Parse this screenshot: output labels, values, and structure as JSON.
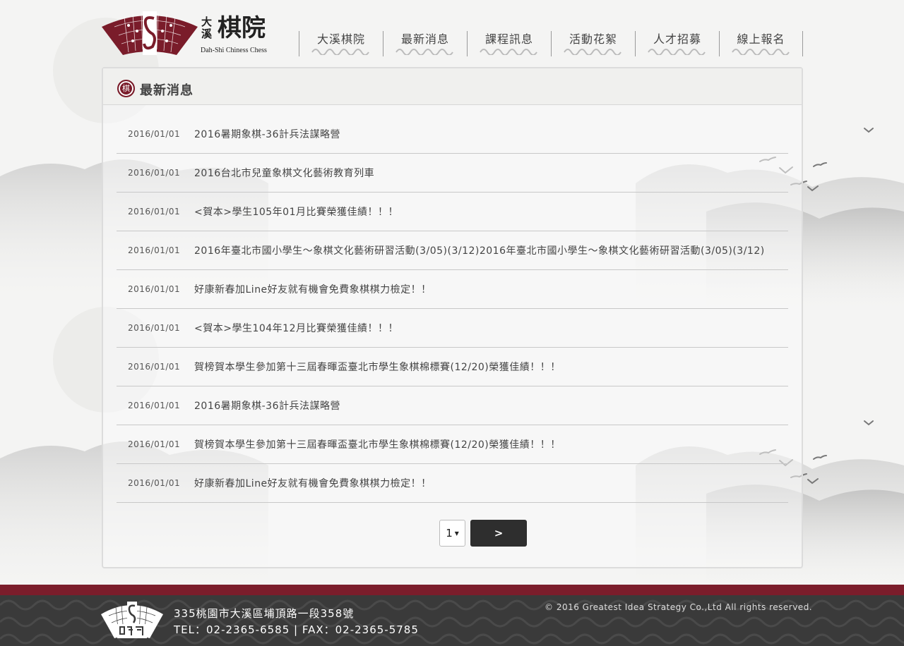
{
  "brand": {
    "name": "棋院",
    "name_small": "大溪",
    "subtitle": "Dah-Shi Chiness Chess",
    "color": "#7a1c2a"
  },
  "nav": {
    "items": [
      {
        "label": "大溪棋院"
      },
      {
        "label": "最新消息"
      },
      {
        "label": "課程訊息"
      },
      {
        "label": "活動花絮"
      },
      {
        "label": "人才招募"
      },
      {
        "label": "線上報名"
      }
    ]
  },
  "panel": {
    "icon_char": "棋",
    "title": "最新消息"
  },
  "news": [
    {
      "date": "2016/01/01",
      "title": "2016暑期象棋-36計兵法謀略營"
    },
    {
      "date": "2016/01/01",
      "title": "2016台北市兒童象棋文化藝術教育列車"
    },
    {
      "date": "2016/01/01",
      "title": "<賀本>學生105年01月比賽榮獲佳績！！！"
    },
    {
      "date": "2016/01/01",
      "title": "2016年臺北市國小學生～象棋文化藝術研習活動(3/05)(3/12)2016年臺北市國小學生～象棋文化藝術研習活動(3/05)(3/12)"
    },
    {
      "date": "2016/01/01",
      "title": "好康新春加Line好友就有機會免費象棋棋力檢定！！"
    },
    {
      "date": "2016/01/01",
      "title": "<賀本>學生104年12月比賽榮獲佳績！！！"
    },
    {
      "date": "2016/01/01",
      "title": "賀榜賀本學生參加第十三屆春暉盃臺北市學生象棋棉標賽(12/20)榮獲佳績！！！"
    },
    {
      "date": "2016/01/01",
      "title": "2016暑期象棋-36計兵法謀略營"
    },
    {
      "date": "2016/01/01",
      "title": "賀榜賀本學生參加第十三屆春暉盃臺北市學生象棋棉標賽(12/20)榮獲佳績！！！"
    },
    {
      "date": "2016/01/01",
      "title": "好康新春加Line好友就有機會免費象棋棋力檢定！！"
    }
  ],
  "pager": {
    "current_page": "1",
    "dropdown_glyph": "▾",
    "next_label": ">"
  },
  "footer": {
    "address": "335桃園市大溪區埔頂路一段358號",
    "tel": "TEL：02-2365-6585  |  FAX：02-2365-5785",
    "copyright": "© 2016 Greatest Idea Strategy Co.,Ltd All rights reserved.",
    "bar_color": "#7b1d2b"
  }
}
